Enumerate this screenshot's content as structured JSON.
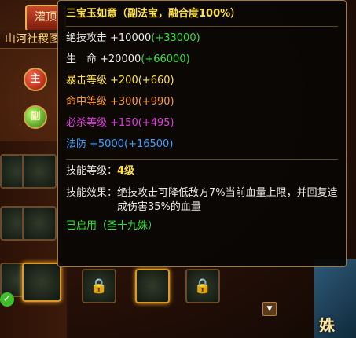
{
  "background": {
    "tab_label": "灌顶",
    "header_text": "山河社稷图",
    "main_orb": "主",
    "sub_orb": "副",
    "right_art_text": "姝",
    "lock_icon": "lock-icon"
  },
  "tooltip": {
    "title": "三宝玉如意（副法宝，融合度100%）",
    "stats": [
      {
        "label": "绝技攻击",
        "value": "+10000",
        "bonus": "(+33000)",
        "color": "#e8e8e8"
      },
      {
        "label": "生　命",
        "value": "+20000",
        "bonus": "(+66000)",
        "color": "#e8e8e8"
      },
      {
        "label": "暴击等级",
        "value": "+200",
        "bonus": "(+660)",
        "color": "#ffe24a"
      },
      {
        "label": "命中等级",
        "value": "+300",
        "bonus": "(+990)",
        "color": "#ff9a2a"
      },
      {
        "label": "必杀等级",
        "value": "+150",
        "bonus": "(+495)",
        "color": "#e23ae2"
      },
      {
        "label": "法防",
        "value": "+5000",
        "bonus": "(+16500)",
        "color": "#3aa0ff"
      }
    ],
    "skill_level_label": "技能等级：",
    "skill_level_value": "4级",
    "skill_effect_label": "技能效果：",
    "skill_effect_text": "绝技攻击可降低敌方7%当前血量上限，并回复造成伤害35%的血量",
    "enabled_text": "已启用（圣十九姝）"
  }
}
